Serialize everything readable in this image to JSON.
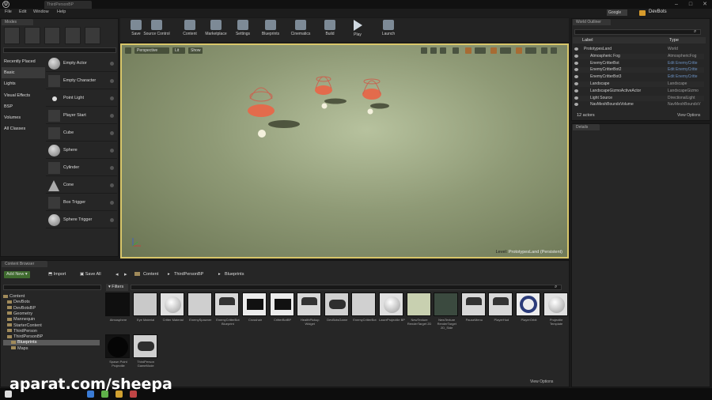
{
  "menu": [
    "File",
    "Edit",
    "Window",
    "Help"
  ],
  "project_tab": "ThirdPersonBP",
  "search_google": "Google",
  "project_name": "DevBots",
  "modes_tab": "Modes",
  "categories": [
    "Recently Placed",
    "Basic",
    "Lights",
    "Visual Effects",
    "BSP",
    "Volumes",
    "All Classes"
  ],
  "selected_category": "Basic",
  "place_items": [
    {
      "label": "Empty Actor",
      "shape": "ball"
    },
    {
      "label": "Empty Character",
      "shape": "box"
    },
    {
      "label": "Point Light",
      "shape": "dot"
    },
    {
      "label": "Player Start",
      "shape": "box"
    },
    {
      "label": "Cube",
      "shape": "box"
    },
    {
      "label": "Sphere",
      "shape": "ball"
    },
    {
      "label": "Cylinder",
      "shape": "box"
    },
    {
      "label": "Cone",
      "shape": "cone"
    },
    {
      "label": "Box Trigger",
      "shape": "box"
    },
    {
      "label": "Sphere Trigger",
      "shape": "ball"
    }
  ],
  "toolbar": [
    "Save",
    "Source Control",
    "Content",
    "Marketplace",
    "Settings",
    "Blueprints",
    "Cinematics",
    "Build",
    "Play",
    "Launch"
  ],
  "viewport": {
    "perspective": "Perspective",
    "lit": "Lit",
    "show": "Show",
    "level_prefix": "Level:",
    "level_name": "PrototypesLand (Persistent)"
  },
  "outliner": {
    "tab": "World Outliner",
    "col_label": "Label",
    "col_type": "Type",
    "rows": [
      {
        "name": "PrototypesLand",
        "type": "World",
        "link": false
      },
      {
        "name": "Atmospheric Fog",
        "type": "AtmosphericFog",
        "link": false
      },
      {
        "name": "EnemyCritterBot",
        "type": "Edit EnemyCritte",
        "link": true
      },
      {
        "name": "EnemyCritterBot2",
        "type": "Edit EnemyCritte",
        "link": true
      },
      {
        "name": "EnemyCritterBot3",
        "type": "Edit EnemyCritte",
        "link": true
      },
      {
        "name": "Landscape",
        "type": "Landscape",
        "link": false
      },
      {
        "name": "LandscapeGizmoActiveActor",
        "type": "LandscapeGizmo",
        "link": false
      },
      {
        "name": "Light Source",
        "type": "DirectionalLight",
        "link": false
      },
      {
        "name": "NavMeshBoundsVolume",
        "type": "NavMeshBoundsV",
        "link": false
      }
    ],
    "count": "12 actors",
    "view_options": "View Options"
  },
  "details_tab": "Details",
  "content_browser": {
    "tab": "Content Browser",
    "add_new": "Add New",
    "import": "Import",
    "save_all": "Save All",
    "breadcrumb": [
      "Content",
      "ThirdPersonBP",
      "Blueprints"
    ],
    "filters": "Filters",
    "view_options": "View Options",
    "tree": [
      {
        "label": "Content",
        "indent": 0
      },
      {
        "label": "DevBots",
        "indent": 1
      },
      {
        "label": "DevBotsBP",
        "indent": 1
      },
      {
        "label": "Geometry",
        "indent": 1
      },
      {
        "label": "Mannequin",
        "indent": 1
      },
      {
        "label": "StarterContent",
        "indent": 1
      },
      {
        "label": "ThirdPerson",
        "indent": 1
      },
      {
        "label": "ThirdPersonBP",
        "indent": 1
      },
      {
        "label": "Blueprints",
        "indent": 2,
        "selected": true
      },
      {
        "label": "Maps",
        "indent": 2
      }
    ],
    "assets": [
      {
        "label": "Atmosphere",
        "thumb": "#0f0f0f",
        "kind": "plain"
      },
      {
        "label": "Eye Material",
        "thumb": "#c9c9c9",
        "kind": "plain"
      },
      {
        "label": "Critter Material",
        "thumb": "#e0e0e0",
        "kind": "ball"
      },
      {
        "label": "EnemySpawner",
        "thumb": "#cfcfcf",
        "kind": "plain"
      },
      {
        "label": "EnemyCritterBot Blueprint",
        "thumb": "#d8d8d8",
        "kind": "heart"
      },
      {
        "label": "Crosshair",
        "thumb": "#ececec",
        "kind": "grid"
      },
      {
        "label": "CritterBotBP",
        "thumb": "#ececec",
        "kind": "grid"
      },
      {
        "label": "HealthPickup Widget",
        "thumb": "#d8d8d8",
        "kind": "heart"
      },
      {
        "label": "DevBotsGame",
        "thumb": "#d0d0d0",
        "kind": "pad"
      },
      {
        "label": "EnemyCritterBot",
        "thumb": "#d0d0d0",
        "kind": "plain"
      },
      {
        "label": "LaserProjectile BP",
        "thumb": "#e0e0e0",
        "kind": "ball"
      },
      {
        "label": "NewTexture RenderTarget 2D",
        "thumb": "#c8d0b0",
        "kind": "plain"
      },
      {
        "label": "NewTexture RenderTarget 2D_Side",
        "thumb": "#3b4a3f",
        "kind": "plain"
      },
      {
        "label": "PauseMenu",
        "thumb": "#d8d8d8",
        "kind": "heart"
      },
      {
        "label": "PlayerHud",
        "thumb": "#d8d8d8",
        "kind": "heart"
      },
      {
        "label": "PlayerOrbit",
        "thumb": "#ededed",
        "kind": "ring"
      },
      {
        "label": "Projectile Template",
        "thumb": "#e0e0e0",
        "kind": "ball"
      },
      {
        "label": "Spawn Point Projectile",
        "thumb": "#121212",
        "kind": "darkball"
      },
      {
        "label": "ThirdPerson GameMode",
        "thumb": "#d0d0d0",
        "kind": "pad"
      }
    ]
  },
  "watermark": "aparat.com/sheepa"
}
